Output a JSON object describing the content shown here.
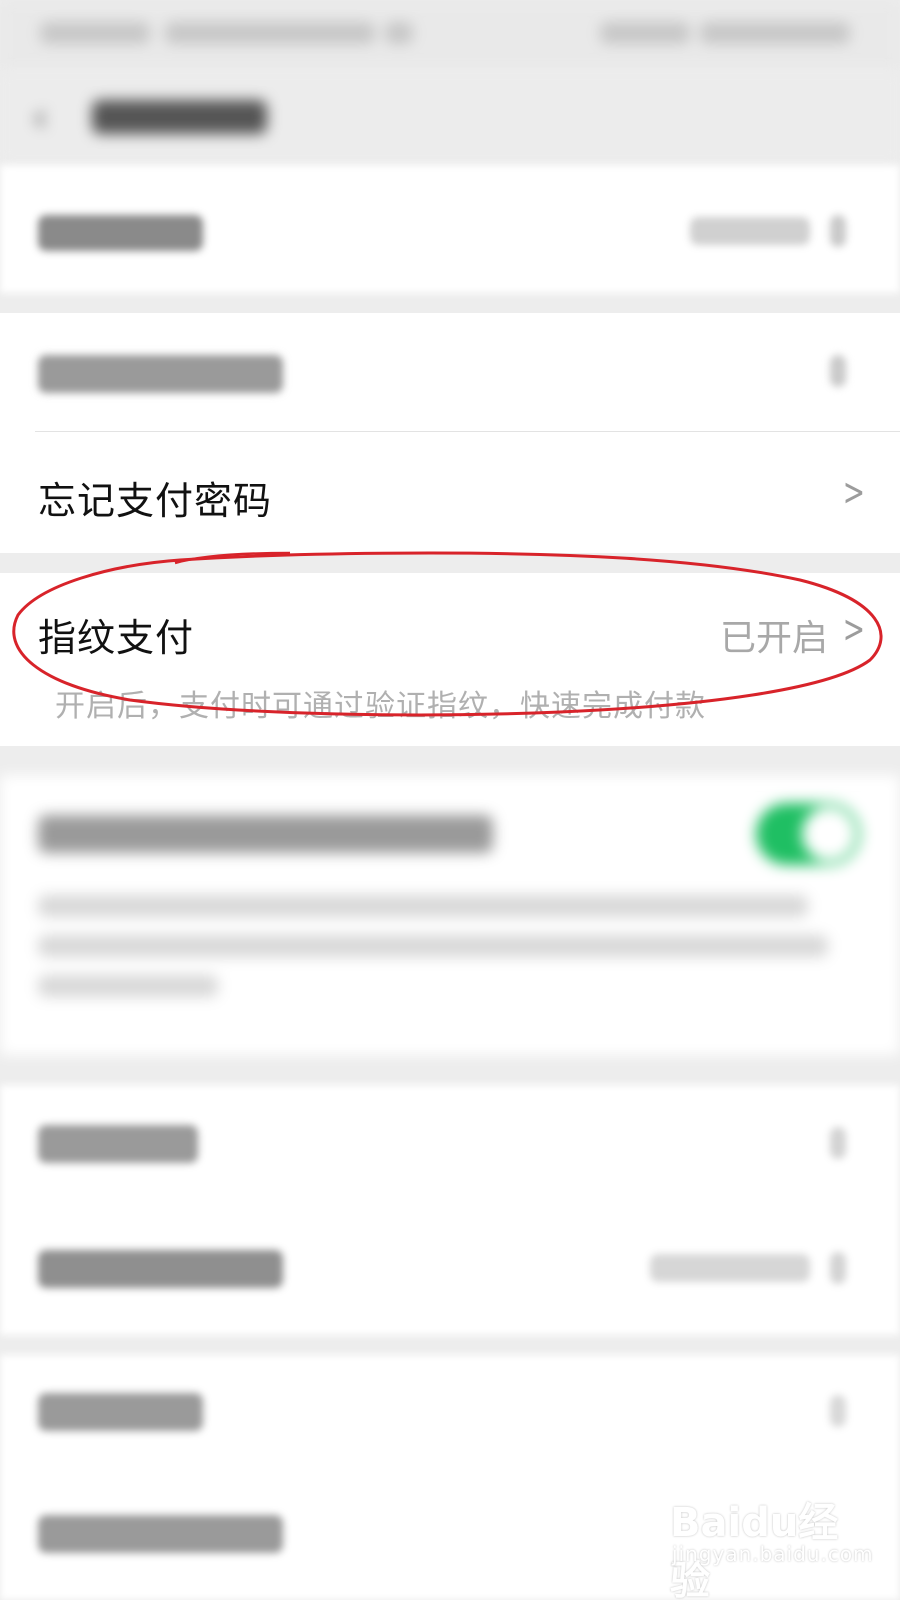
{
  "rows": {
    "forget_password": {
      "label": "忘记支付密码"
    },
    "fingerprint_pay": {
      "label": "指纹支付",
      "value": "已开启"
    }
  },
  "hints": {
    "fingerprint_pay": "开启后，支付时可通过验证指纹，快速完成付款"
  },
  "watermark": {
    "brand": "Baidu经验",
    "url": "jingyan.baidu.com"
  },
  "colors": {
    "toggle_on": "#1fbf63",
    "annotation_red": "#d8232a",
    "background": "#ededed"
  },
  "icons": {
    "chevron": "chevron-right-icon",
    "back": "chevron-left-icon"
  }
}
